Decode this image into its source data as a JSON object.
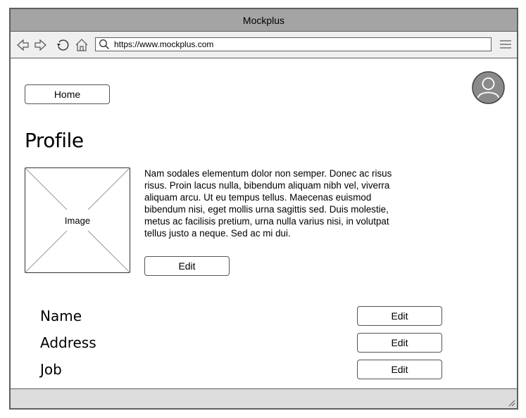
{
  "window": {
    "title": "Mockplus"
  },
  "browser": {
    "url": "https://www.mockplus.com",
    "icons": {
      "back": "back-arrow-icon",
      "forward": "forward-arrow-icon",
      "reload": "reload-icon",
      "home": "home-icon",
      "search": "search-icon",
      "menu": "hamburger-menu-icon",
      "resize": "resize-grip-icon"
    }
  },
  "page": {
    "home_button": "Home",
    "title": "Profile",
    "image_label": "Image",
    "bio": "Nam sodales elementum dolor non semper. Donec ac risus risus. Proin lacus nulla, bibendum aliquam nibh vel, viverra aliquam arcu. Ut eu tempus tellus. Maecenas euismod bibendum nisi, eget mollis urna sagittis sed. Duis molestie, metus ac facilisis pretium, urna nulla varius nisi, in volutpat tellus justo a neque. Sed ac mi dui.",
    "bio_edit_button": "Edit",
    "fields": [
      {
        "label": "Name",
        "edit": "Edit"
      },
      {
        "label": "Address",
        "edit": "Edit"
      },
      {
        "label": "Job",
        "edit": "Edit"
      }
    ],
    "avatar_icon": "user-avatar-icon"
  },
  "colors": {
    "titlebar": "#a4a4a4",
    "toolbar": "#efefef",
    "statusbar": "#dcdcdc",
    "border": "#5f5f5f",
    "avatar_fill": "#8a8a8a"
  }
}
